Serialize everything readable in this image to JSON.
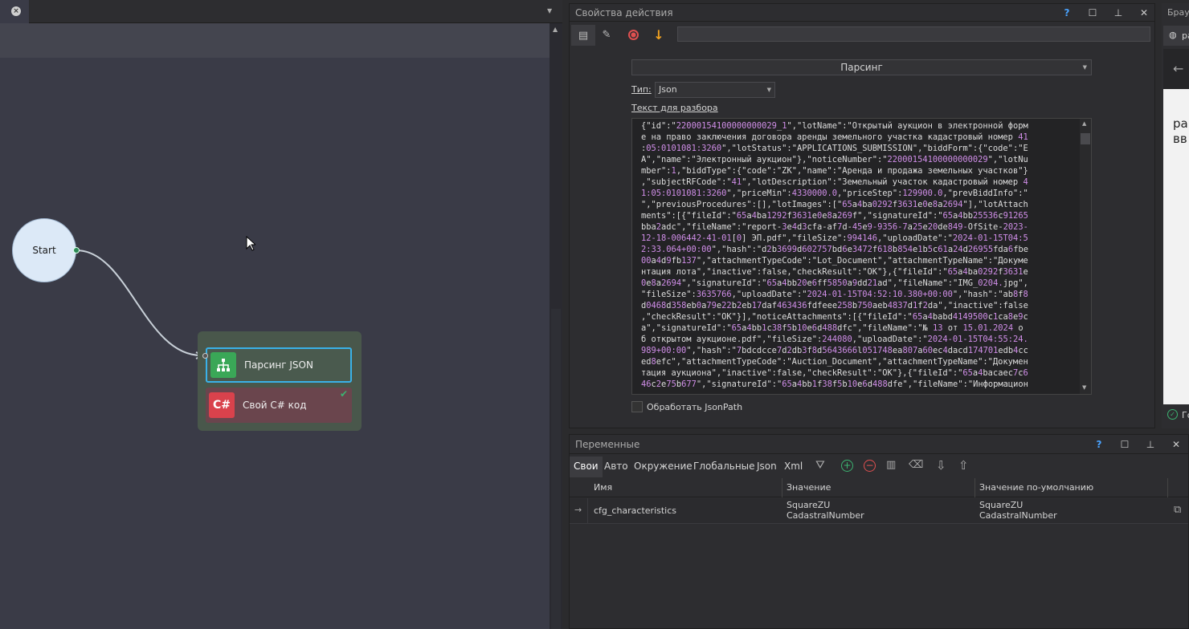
{
  "canvas": {
    "start_label": "Start",
    "actions": [
      {
        "label": "Парсинг JSON"
      },
      {
        "label": "Свой C# код",
        "icon_text": "C#"
      }
    ]
  },
  "props": {
    "title": "Свойства действия",
    "help": "?",
    "action_select": "Парсинг",
    "type_label": "Тип:",
    "type_value": "Json",
    "text_label": "Текст для разбора",
    "jsonpath_label": "Обработать JsonPath",
    "json_lines": [
      "{\"id\":\"22000154100000000029_1\",\"lotName\":\"Открытый аукцион в электронной форм",
      "е на право заключения договора аренды земельного участка кадастровый номер 41",
      ":05:0101081:3260\",\"lotStatus\":\"APPLICATIONS_SUBMISSION\",\"biddForm\":{\"code\":\"E",
      "A\",\"name\":\"Электронный аукцион\"},\"noticeNumber\":\"22000154100000000029\",\"lotNu",
      "mber\":1,\"biddType\":{\"code\":\"ZK\",\"name\":\"Аренда и продажа земельных участков\"}",
      ",\"subjectRFCode\":\"41\",\"lotDescription\":\"Земельный участок кадастровый номер 4",
      "1:05:0101081:3260\",\"priceMin\":4330000.0,\"priceStep\":129900.0,\"prevBiddInfo\":\"",
      "\",\"previousProcedures\":[],\"lotImages\":[\"65a4ba0292f3631e0e8a2694\"],\"lotAttach",
      "ments\":[{\"fileId\":\"65a4ba1292f3631e0e8a269f\",\"signatureId\":\"65a4bb25536c91265",
      "bba2adc\",\"fileName\":\"report-3e4d3cfa-af7d-45e9-9356-7a25e20de849-OfSite-2023-",
      "12-18-006442-41-01[0] ЭП.pdf\",\"fileSize\":994146,\"uploadDate\":\"2024-01-15T04:5",
      "2:33.064+00:00\",\"hash\":\"d2b3699d602757bd6e3472f618b854e1b5c61a24d26955fda6fbe",
      "00a4d9fb137\",\"attachmentTypeCode\":\"Lot_Document\",\"attachmentTypeName\":\"Докуме",
      "нтация лота\",\"inactive\":false,\"checkResult\":\"OK\"},{\"fileId\":\"65a4ba0292f3631e",
      "0e8a2694\",\"signatureId\":\"65a4bb20e6ff5850a9dd21ad\",\"fileName\":\"IMG_0204.jpg\",",
      "\"fileSize\":3635766,\"uploadDate\":\"2024-01-15T04:52:10.380+00:00\",\"hash\":\"ab8f8",
      "d0468d358eb0a79e22b2eb17daf463436fdfeee258b750aeb4837d1f2da\",\"inactive\":false",
      ",\"checkResult\":\"OK\"}],\"noticeAttachments\":[{\"fileId\":\"65a4babd4149500c1ca8e9c",
      "a\",\"signatureId\":\"65a4bb1c38f5b10e6d488dfc\",\"fileName\":\"№ 13 от 15.01.2024 о",
      "б открытом аукционе.pdf\",\"fileSize\":244080,\"uploadDate\":\"2024-01-15T04:55:24.",
      "989+00:00\",\"hash\":\"7bdcdcce7d2db3f8d5643666l051748ea807a60ec4dacd174701edb4cc",
      "ed8efc\",\"attachmentTypeCode\":\"Auction_Document\",\"attachmentTypeName\":\"Докумен",
      "тация аукциона\",\"inactive\":false,\"checkResult\":\"OK\"},{\"fileId\":\"65a4bacaec7c6",
      "46c2e75b677\",\"signatureId\":\"65a4bb1f38f5b10e6d488dfe\",\"fileName\":\"Информацион"
    ]
  },
  "vars": {
    "title": "Переменные",
    "help": "?",
    "tabs": [
      "Свои",
      "Авто",
      "Окружение",
      "Глобальные",
      "Json",
      "Xml"
    ],
    "columns": [
      "Имя",
      "Значение",
      "Значение по-умолчанию"
    ],
    "rows": [
      {
        "name": "cfg_characteristics",
        "value1": "SquareZU",
        "value2": "CadastralNumber",
        "default1": "SquareZU",
        "default2": "CadastralNumber"
      }
    ]
  },
  "browser": {
    "title": "Брауз",
    "tab": "ра",
    "text1": "ра",
    "text2": "вв",
    "footer": "Го"
  },
  "colors": {
    "accent": "#3ab1e8",
    "json_string": "#d08ee8",
    "record": "#e05050",
    "arrow": "#f0a020",
    "add": "#3cb371",
    "remove": "#e05050"
  }
}
